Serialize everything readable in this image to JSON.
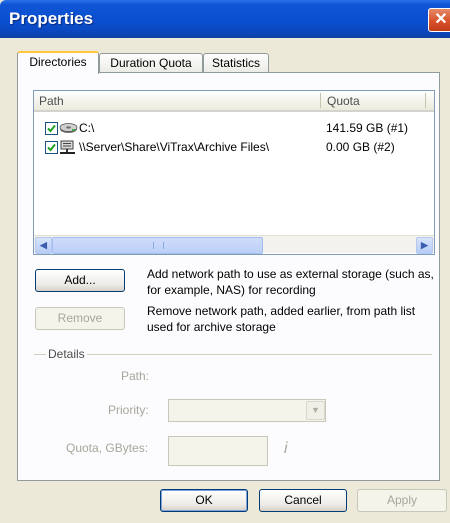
{
  "window": {
    "title": "Properties",
    "close_glyph": "✕"
  },
  "tabs": [
    {
      "label": "Directories",
      "active": true
    },
    {
      "label": "Duration Quota",
      "active": false
    },
    {
      "label": "Statistics",
      "active": false
    }
  ],
  "list": {
    "columns": [
      "Path",
      "Quota"
    ],
    "rows": [
      {
        "checked": true,
        "icon": "local-drive-icon",
        "path": "C:\\",
        "quota": "141.59 GB (#1)"
      },
      {
        "checked": true,
        "icon": "network-drive-icon",
        "path": "\\\\Server\\Share\\ViTrax\\Archive Files\\",
        "quota": "0.00 GB (#2)"
      }
    ]
  },
  "actions": {
    "add_label": "Add...",
    "add_description": "Add network path to use as external storage (such as, for example, NAS) for recording",
    "remove_label": "Remove",
    "remove_description": "Remove network path, added earlier, from path list used for archive storage"
  },
  "details": {
    "group_label": "Details",
    "path_label": "Path:",
    "priority_label": "Priority:",
    "quota_label": "Quota, GBytes:",
    "quota_value": "",
    "info_glyph": "i"
  },
  "footer": {
    "ok_label": "OK",
    "cancel_label": "Cancel",
    "apply_label": "Apply"
  },
  "colors": {
    "title_bar": "#0a4fd0",
    "tab_highlight": "#ffc83c",
    "disabled_text": "#a8a69a"
  }
}
